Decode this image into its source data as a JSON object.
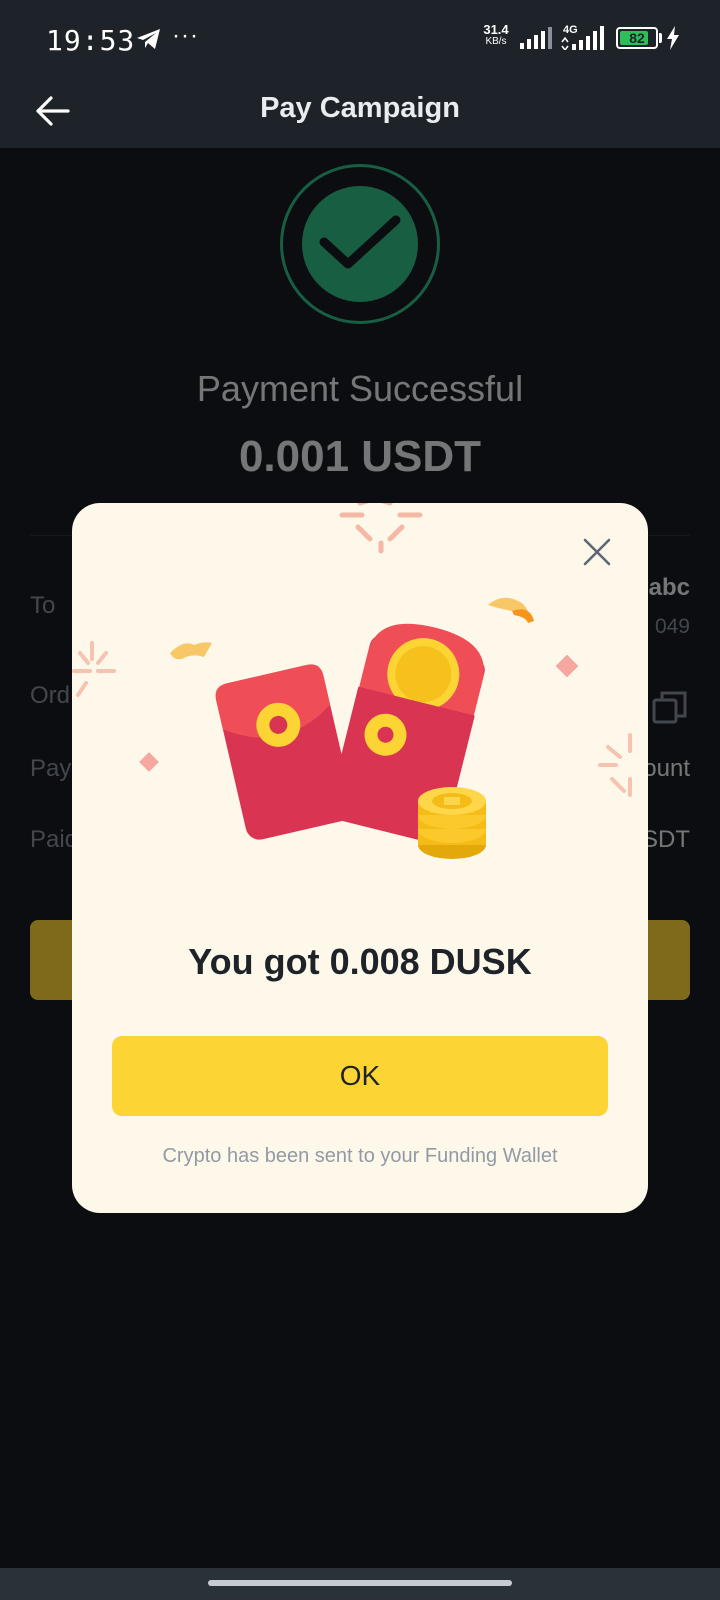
{
  "status_bar": {
    "time": "19:53",
    "more": "···",
    "net_speed_value": "31.4",
    "net_speed_unit": "KB/s",
    "network_type": "4G",
    "battery_level": "82",
    "battery_fraction": 0.82
  },
  "header": {
    "title": "Pay Campaign"
  },
  "payment": {
    "status": "Payment Successful",
    "amount": "0.001 USDT",
    "rows": [
      {
        "label": "To",
        "value": "abc",
        "sub": "049"
      },
      {
        "label": "Ord"
      },
      {
        "label": "Pay",
        "value": "ount"
      },
      {
        "label": "Paid",
        "value": "SDT"
      }
    ]
  },
  "modal": {
    "reward_text": "You got 0.008 DUSK",
    "ok_label": "OK",
    "footnote": "Crypto has been sent to your Funding Wallet"
  },
  "colors": {
    "accent": "#fcd535",
    "success": "#2ebd85",
    "modal_bg": "#fdf8ea",
    "envelope_red": "#e8364b"
  }
}
